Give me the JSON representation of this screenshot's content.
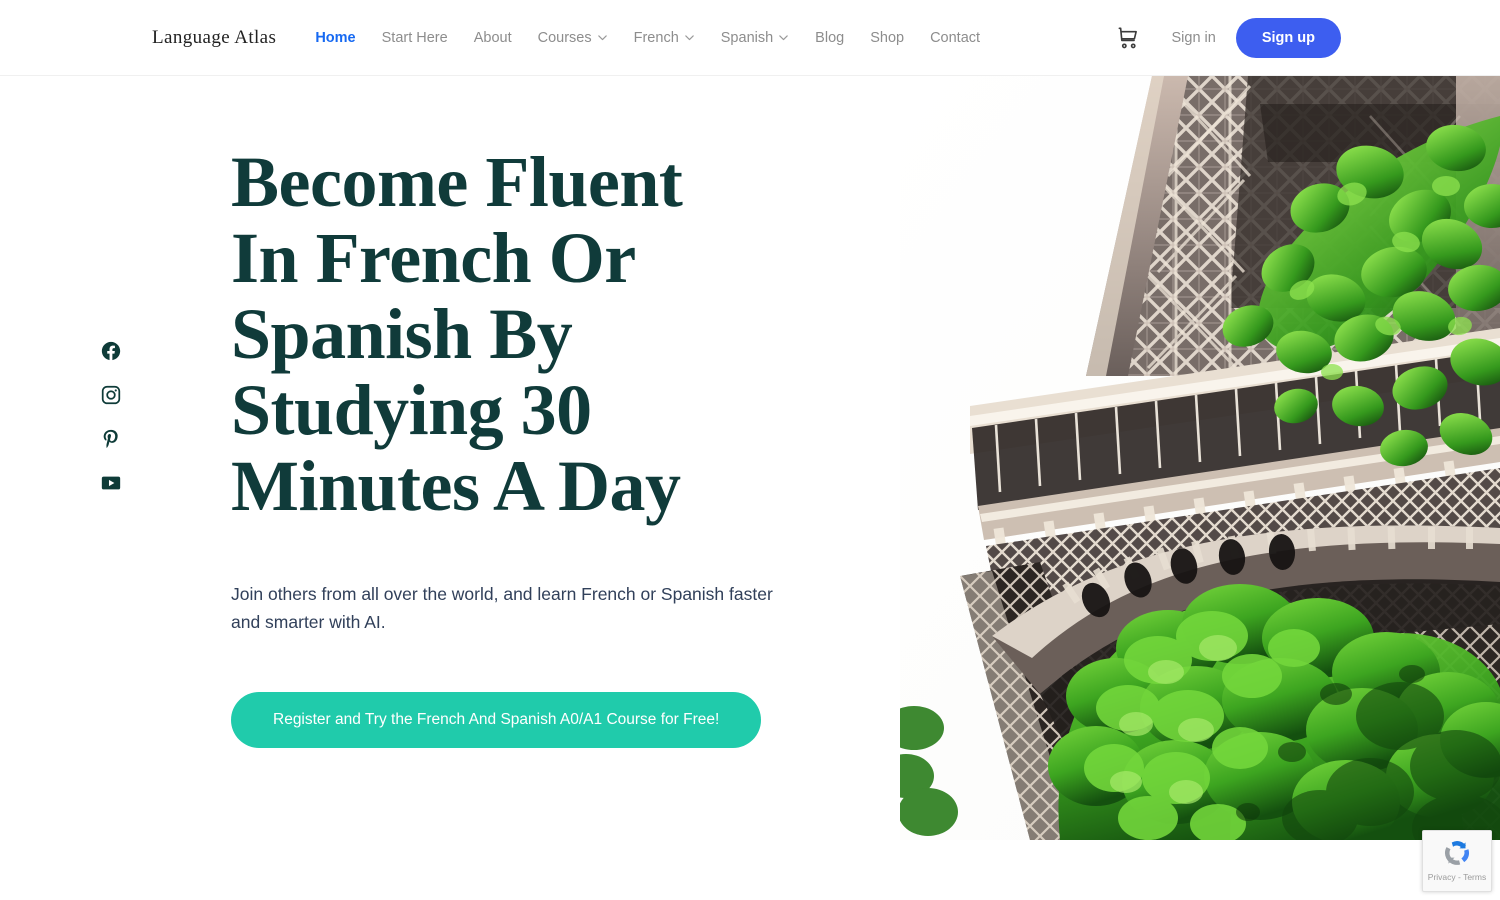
{
  "header": {
    "logo": "Language Atlas",
    "nav": [
      {
        "label": "Home",
        "active": true,
        "caret": false
      },
      {
        "label": "Start Here",
        "active": false,
        "caret": false
      },
      {
        "label": "About",
        "active": false,
        "caret": false
      },
      {
        "label": "Courses",
        "active": false,
        "caret": true
      },
      {
        "label": "French",
        "active": false,
        "caret": true
      },
      {
        "label": "Spanish",
        "active": false,
        "caret": true
      },
      {
        "label": "Blog",
        "active": false,
        "caret": false
      },
      {
        "label": "Shop",
        "active": false,
        "caret": false
      },
      {
        "label": "Contact",
        "active": false,
        "caret": false
      }
    ],
    "cart_icon": "shopping-cart-icon",
    "signin_label": "Sign in",
    "signup_label": "Sign up",
    "signup_color": "#3d5ef0",
    "active_link_color": "#1669f2"
  },
  "social": [
    {
      "name": "facebook-icon",
      "label": "Facebook"
    },
    {
      "name": "instagram-icon",
      "label": "Instagram"
    },
    {
      "name": "pinterest-icon",
      "label": "Pinterest"
    },
    {
      "name": "youtube-icon",
      "label": "YouTube"
    }
  ],
  "hero": {
    "headline": "Become Fluent In French Or Spanish By Studying 30 Minutes A Day",
    "headline_color": "#103b3a",
    "subheadline": "Join others from all over the world, and learn French or Spanish faster and smarter with AI.",
    "cta_label": "Register and Try the French And Spanish A0/A1 Course for Free!",
    "cta_color": "#20cbab",
    "image_alt": "Eiffel Tower with green tree foliage"
  },
  "recaptcha": {
    "text": "Privacy - Terms",
    "logo_name": "recaptcha-logo-icon"
  }
}
